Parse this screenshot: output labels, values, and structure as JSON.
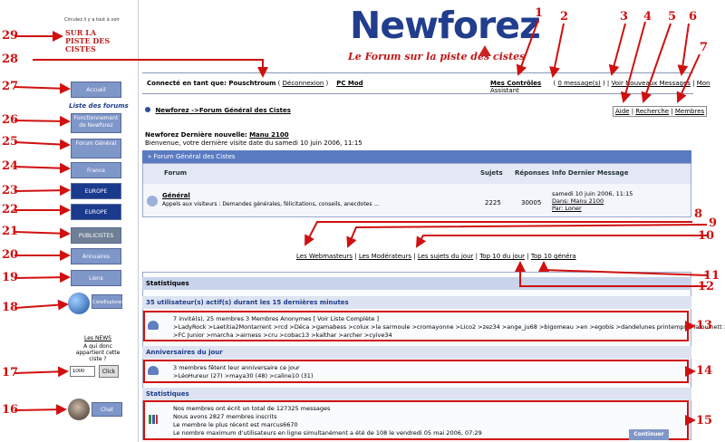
{
  "brand": {
    "title": "Newforez",
    "subtitle": "Le Forum sur la piste des cistes"
  },
  "leftcol": {
    "top_small_1": "Circulez il y a tout à voir",
    "logo_small": "SUR LA PISTE DES CISTES",
    "nav": {
      "accueil": "Accueil",
      "liste": "Liste des forums",
      "fonctionnement": "Fonctionnement de Newforez",
      "forum_general": "Forum Général",
      "france": "France",
      "europe": "EUROPE",
      "outside_europe": "EUROPE",
      "publicistes": "PUBLICISTES",
      "annuaires": "Annuaires",
      "liens": "Liens",
      "cisteexplorer": "CisteExplorer",
      "chat": "Chat"
    },
    "quiz": {
      "title": "Les NEWS",
      "question": "A qui donc appartient cette ciste ?",
      "input_value": "1000",
      "click": "Click"
    }
  },
  "userbar": {
    "prefix": "Connecté en tant que: Pouschtroum",
    "deconnexion": "Déconnexion",
    "pcmod": "PC Mod"
  },
  "toplinks": {
    "controles": "Mes Contrôles",
    "messages": "0 message(s)",
    "nouveaux": "Voir Nouveaux Messages",
    "assistant": "Mon Assistant"
  },
  "links2": {
    "aide": "Aide",
    "recherche": "Recherche",
    "membres": "Membres"
  },
  "breadcrumb": "Newforez ->Forum Général des Cistes",
  "news": {
    "line1_prefix": "Newforez Dernière nouvelle:",
    "line1_link": "Manu 2100",
    "line2": "Bienvenue, votre dernière visite date du samedi 10 juin 2006, 11:15"
  },
  "forum_table": {
    "title": "Forum Général des Cistes",
    "headers": {
      "forum": "Forum",
      "sujets": "Sujets",
      "reponses": "Réponses",
      "info": "Info Dernier Message"
    },
    "row": {
      "name": "Général",
      "desc": "Appels aux visiteurs : Demandes générales, félicitations, conseils, anecdotes ...",
      "sujets": "2225",
      "reponses": "30005",
      "info1": "samedi 10 juin 2006, 11:15",
      "info2": "Dans: Manu 2100",
      "info3": "Par: Loner"
    }
  },
  "midlinks": {
    "webmasters": "Les Webmasteurs",
    "moderateurs": "Les Modérateurs",
    "sujets": "Les sujets du jour",
    "top10jour": "Top 10 du jour",
    "top10general": "Top 10 généra"
  },
  "stats": {
    "title": "Statistiques",
    "active_head": "35 utilisateur(s) actif(s) durant les 15 dernières minutes",
    "active_line1": "7 invité(s), 25 membres 3 Membres Anonymes [ Voir Liste Complète ]",
    "active_line2": ">LadyRock >Laetitia2Montarrent >rcd >Déca >gamabess >colux >la sarmoule >cromayonne >Lico2 >zez34 >ange_ju68 >bigomeau >en >egobis >dandelunes printemps >lafouinett >dca34",
    "active_line3": ">FC Junior >marcha >airness >cru >cobac13 >kalthar >archer >cyive34",
    "anniv_head": "Anniversaires du jour",
    "anniv_line1": "3 membres fêtent leur anniversaire ce jour",
    "anniv_line2": ">LéoHureur (27) >maya30 (48) >caline10 (31)",
    "stats_head": "Statistiques",
    "stats_line1": "Nos membres ont écrit un total de 127325 messages",
    "stats_line2": "Nous avons 2827 membres inscrits",
    "stats_line3": "Le membre le plus récent est marcus6670",
    "stats_line4": "Le nombre maximum d'utilisateurs en ligne simultanément a été de 108 le vendredi 05 mai 2006, 07:29",
    "continue": "Continuer"
  },
  "annotations": [
    "1",
    "2",
    "3",
    "4",
    "5",
    "6",
    "7",
    "8",
    "9",
    "10",
    "11",
    "12",
    "13",
    "14",
    "15",
    "16",
    "17",
    "18",
    "19",
    "20",
    "21",
    "22",
    "23",
    "24",
    "25",
    "26",
    "27",
    "28",
    "29"
  ],
  "colors": {
    "annotation": "#d01010",
    "nav_button": "#7f96c8",
    "brand": "#213d8d",
    "table_header": "#5a7bc2"
  }
}
